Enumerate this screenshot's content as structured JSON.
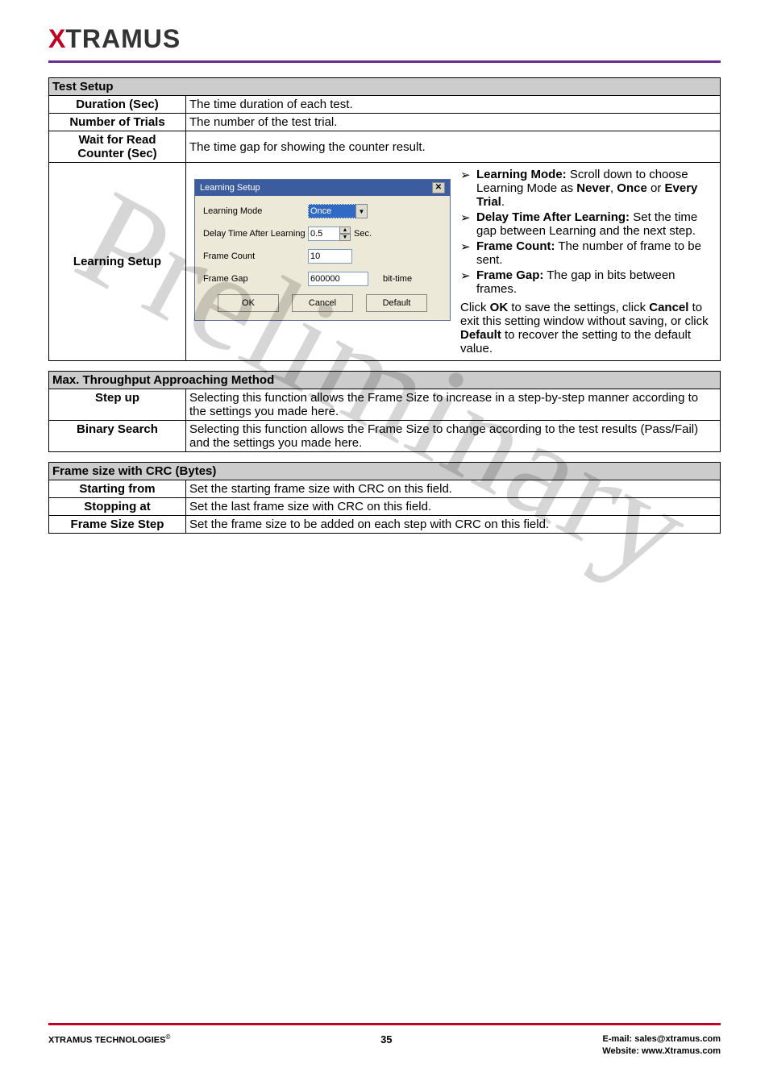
{
  "brand": {
    "x": "X",
    "rest": "TRAMUS"
  },
  "tables": {
    "test_setup": {
      "title": "Test Setup",
      "rows": {
        "duration": {
          "label": "Duration (Sec)",
          "desc": "The time duration of each test."
        },
        "trials": {
          "label": "Number of Trials",
          "desc": "The number of the test trial."
        },
        "wait": {
          "label1": "Wait for Read",
          "label2": "Counter (Sec)",
          "desc": "The time gap for showing the counter result."
        },
        "learning": {
          "label": "Learning Setup"
        }
      }
    },
    "max_method": {
      "title": "Max. Throughput Approaching Method",
      "rows": {
        "stepup": {
          "label": "Step up",
          "desc": "Selecting this function allows the Frame Size to increase in a step-by-step manner according to the settings you made here."
        },
        "binary": {
          "label": "Binary Search",
          "desc": "Selecting this function allows the Frame Size to change according to the test results (Pass/Fail) and the settings you made here."
        }
      }
    },
    "frame_size": {
      "title": "Frame size with CRC (Bytes)",
      "rows": {
        "start": {
          "label": "Starting from",
          "desc": "Set the starting frame size with CRC on this field."
        },
        "stop": {
          "label": "Stopping at",
          "desc": "Set the last frame size with CRC on this field."
        },
        "step": {
          "label": "Frame Size Step",
          "desc": "Set the frame size to be added on each step with CRC on this field."
        }
      }
    }
  },
  "dialog": {
    "title": "Learning Setup",
    "fields": {
      "mode": {
        "label": "Learning Mode",
        "value": "Once"
      },
      "delay": {
        "label": "Delay Time After Learning",
        "value": "0.5",
        "unit": "Sec."
      },
      "count": {
        "label": "Frame Count",
        "value": "10"
      },
      "gap": {
        "label": "Frame Gap",
        "value": "600000",
        "unit": "bit-time"
      }
    },
    "buttons": {
      "ok": "OK",
      "cancel": "Cancel",
      "default": "Default"
    }
  },
  "learning_desc": {
    "b1a": "Learning Mode:",
    "b1b": " Scroll down to choose Learning Mode as ",
    "b1c": "Never",
    "b1d": ", ",
    "b1e": "Once",
    "b1f": " or ",
    "b1g": "Every Trial",
    "b1h": ".",
    "b2a": "Delay Time After Learning:",
    "b2b": " Set the time gap between Learning and the next step.",
    "b3a": "Frame Count:",
    "b3b": " The number of frame to be sent.",
    "b4a": "Frame Gap:",
    "b4b": " The gap in bits between frames.",
    "p1": "Click ",
    "p2": "OK",
    "p3": " to save the settings, click ",
    "p4": "Cancel",
    "p5": " to exit this setting window without saving, or click ",
    "p6": "Default",
    "p7": " to recover the setting to the default value."
  },
  "watermark": "Preliminary",
  "footer": {
    "left1": "XTRAMUS TECHNOLOGIES",
    "left2": "©",
    "page": "35",
    "email_label": "E-mail: ",
    "email": "sales@xtramus.com",
    "web_label": "Website:  ",
    "web": "www.Xtramus.com"
  }
}
